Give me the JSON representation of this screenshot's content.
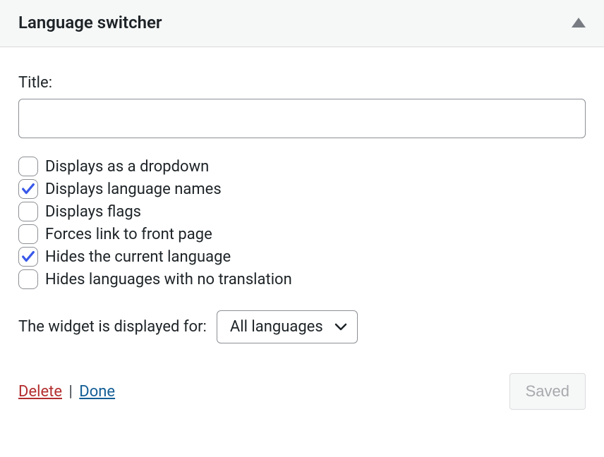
{
  "header": {
    "title": "Language switcher"
  },
  "form": {
    "title_label": "Title:",
    "title_value": "",
    "options": [
      {
        "label": "Displays as a dropdown",
        "checked": false
      },
      {
        "label": "Displays language names",
        "checked": true
      },
      {
        "label": "Displays flags",
        "checked": false
      },
      {
        "label": "Forces link to front page",
        "checked": false
      },
      {
        "label": "Hides the current language",
        "checked": true
      },
      {
        "label": "Hides languages with no translation",
        "checked": false
      }
    ],
    "display_for_label": "The widget is displayed for:",
    "display_for_value": "All languages"
  },
  "footer": {
    "delete": "Delete",
    "separator": "|",
    "done": "Done",
    "saved": "Saved"
  }
}
